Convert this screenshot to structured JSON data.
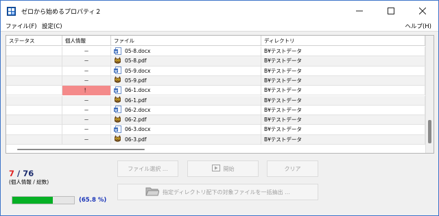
{
  "window": {
    "title": "ゼロから始めるプロパティ２"
  },
  "menu": {
    "file": "ファイル(F)",
    "settings": "設定(C)",
    "help": "ヘルプ(H)"
  },
  "table": {
    "columns": [
      "ステータス",
      "個人情報",
      "ファイル",
      "ディレクトリ"
    ],
    "rows": [
      {
        "status": "",
        "personal": "－",
        "file": "05-8.docx",
        "file_icon": "word-doc-icon",
        "dir": "B¥テストデータ"
      },
      {
        "status": "",
        "personal": "－",
        "file": "05-8.pdf",
        "file_icon": "pdf-owl-icon",
        "dir": "B¥テストデータ"
      },
      {
        "status": "",
        "personal": "－",
        "file": "05-9.docx",
        "file_icon": "word-doc-icon",
        "dir": "B¥テストデータ"
      },
      {
        "status": "",
        "personal": "－",
        "file": "05-9.pdf",
        "file_icon": "pdf-owl-icon",
        "dir": "B¥テストデータ"
      },
      {
        "status": "",
        "personal": "！",
        "file": "06-1.docx",
        "file_icon": "word-doc-icon",
        "dir": "B¥テストデータ",
        "flagged": true
      },
      {
        "status": "",
        "personal": "－",
        "file": "06-1.pdf",
        "file_icon": "pdf-owl-icon",
        "dir": "B¥テストデータ"
      },
      {
        "status": "",
        "personal": "－",
        "file": "06-2.docx",
        "file_icon": "word-doc-icon",
        "dir": "B¥テストデータ"
      },
      {
        "status": "",
        "personal": "－",
        "file": "06-2.pdf",
        "file_icon": "pdf-owl-icon",
        "dir": "B¥テストデータ"
      },
      {
        "status": "",
        "personal": "－",
        "file": "06-3.docx",
        "file_icon": "word-doc-icon",
        "dir": "B¥テストデータ"
      },
      {
        "status": "",
        "personal": "－",
        "file": "06-3.pdf",
        "file_icon": "pdf-owl-icon",
        "dir": "B¥テストデータ"
      }
    ]
  },
  "summary": {
    "personal_count": "7",
    "separator": " / ",
    "total_count": "76",
    "caption": "(個人情報 / 総数)"
  },
  "progress": {
    "value_percent": 65.8,
    "label": "(65.8 %)"
  },
  "buttons": {
    "select_file": "ファイル選択 …",
    "start": "開始",
    "clear": "クリア",
    "extract": "指定ディレクトリ配下の対象ファイルを一括抽出 …"
  },
  "colors": {
    "flag_bg": "#f48a8a",
    "personal_count": "#e02020",
    "progress_fill": "#06b025",
    "progress_text": "#1a35b8"
  }
}
